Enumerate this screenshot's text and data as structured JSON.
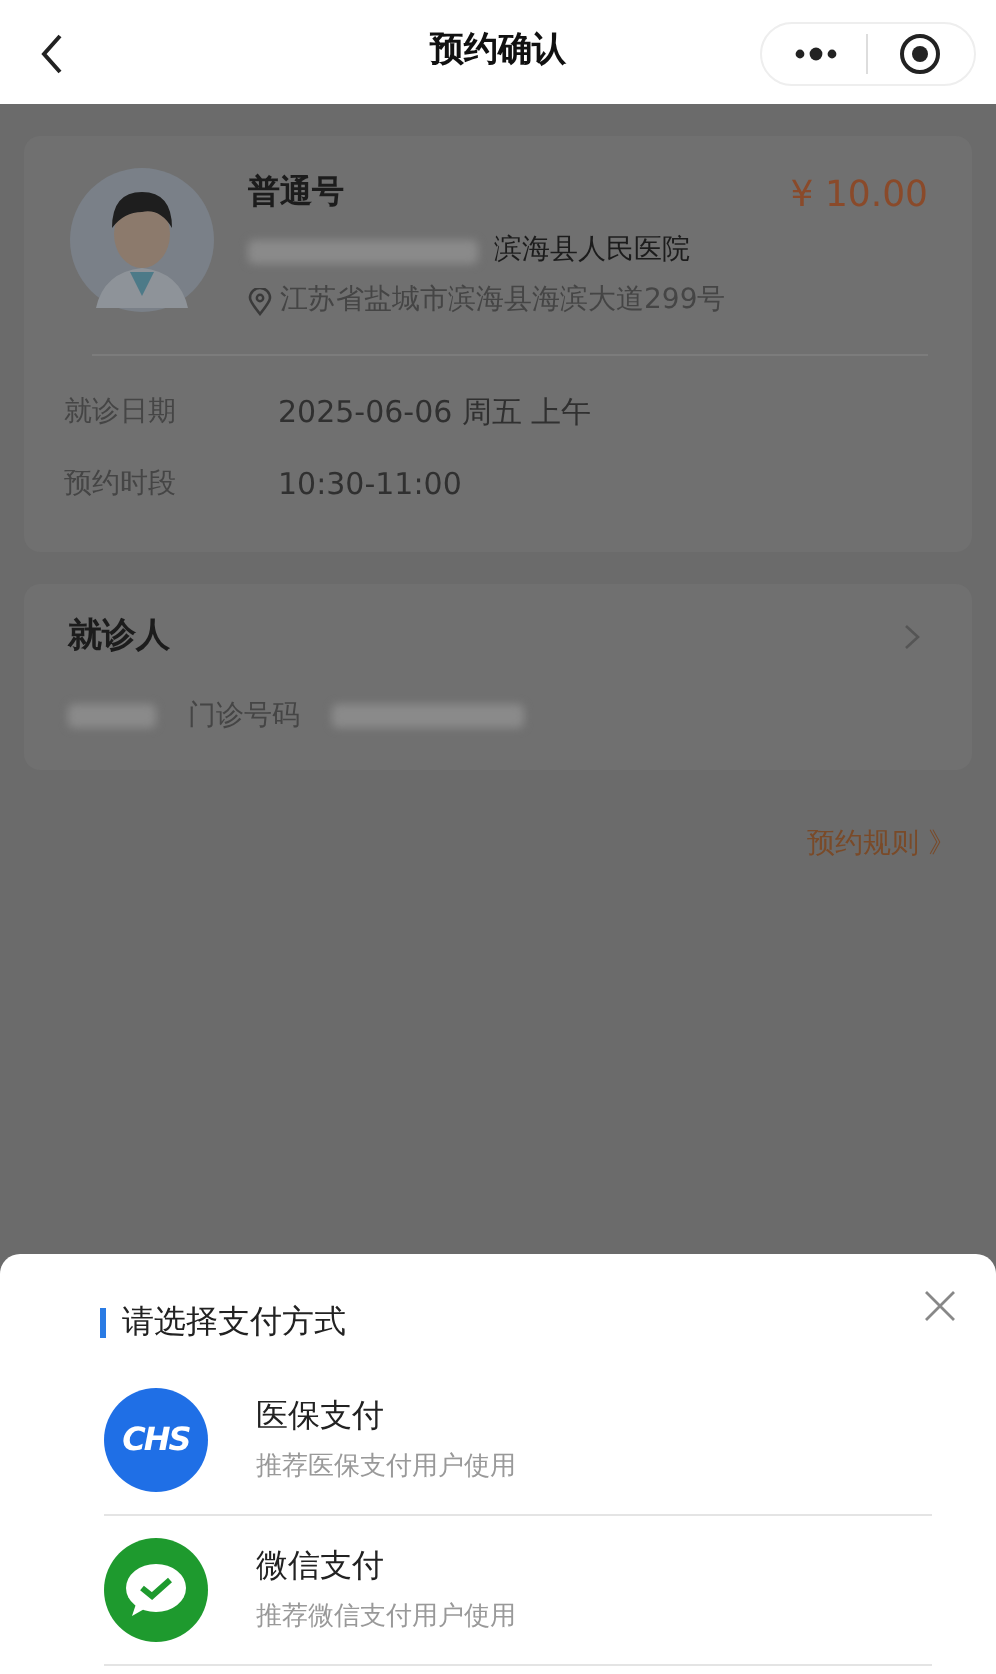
{
  "nav": {
    "title": "预约确认"
  },
  "appointment": {
    "type": "普通号",
    "price": "¥ 10.00",
    "hospital": "滨海县人民医院",
    "address": "江苏省盐城市滨海县海滨大道299号",
    "details": [
      {
        "label": "就诊日期",
        "value": "2025-06-06 周五 上午"
      },
      {
        "label": "预约时段",
        "value": "10:30-11:00"
      }
    ]
  },
  "patient": {
    "title": "就诊人",
    "record_label": "门诊号码"
  },
  "rules_link": "预约规则 》",
  "payment_sheet": {
    "title": "请选择支付方式",
    "methods": [
      {
        "kind": "insurance",
        "logo_text": "CHS",
        "name": "医保支付",
        "hint": "推荐医保支付用户使用"
      },
      {
        "kind": "wechat",
        "name": "微信支付",
        "hint": "推荐微信支付用户使用"
      }
    ]
  }
}
